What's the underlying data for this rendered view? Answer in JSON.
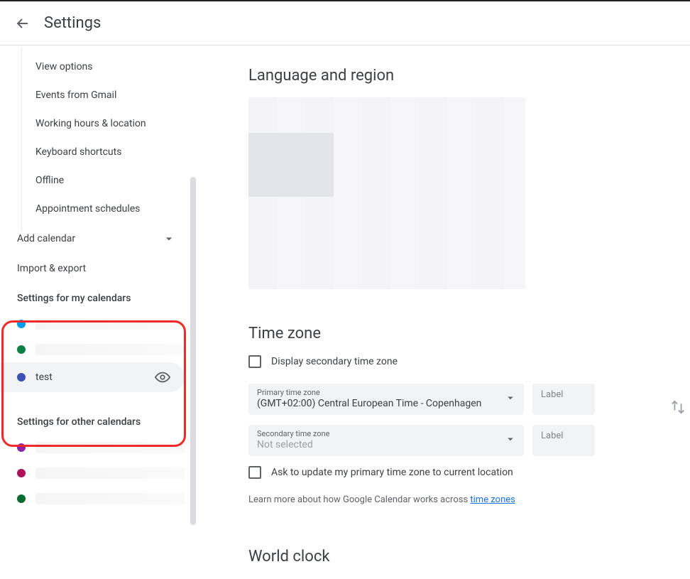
{
  "header": {
    "title": "Settings"
  },
  "sidebar": {
    "items": [
      "View options",
      "Events from Gmail",
      "Working hours & location",
      "Keyboard shortcuts",
      "Offline",
      "Appointment schedules"
    ],
    "add_calendar": "Add calendar",
    "import_export": "Import & export",
    "my_calendars_header": "Settings for my calendars",
    "my_calendars": [
      {
        "color": "#039be5",
        "label": ""
      },
      {
        "color": "#0b8043",
        "label": ""
      },
      {
        "color": "#3f51b5",
        "label": "test",
        "highlighted": true
      }
    ],
    "other_calendars_header": "Settings for other calendars",
    "other_calendars": [
      {
        "color": "#8e24aa",
        "label": ""
      },
      {
        "color": "#ad1457",
        "label": ""
      },
      {
        "color": "#096b30",
        "label": ""
      }
    ]
  },
  "main": {
    "language_region_title": "Language and region",
    "timezone_title": "Time zone",
    "display_secondary": "Display secondary time zone",
    "primary_tz_label": "Primary time zone",
    "primary_tz_value": "(GMT+02:00) Central European Time - Copenhagen",
    "secondary_tz_label": "Secondary time zone",
    "secondary_tz_value": "Not selected",
    "label_placeholder": "Label",
    "ask_update": "Ask to update my primary time zone to current location",
    "learn_more_prefix": "Learn more about how Google Calendar works across ",
    "learn_more_link": "time zones",
    "world_clock_title": "World clock"
  }
}
